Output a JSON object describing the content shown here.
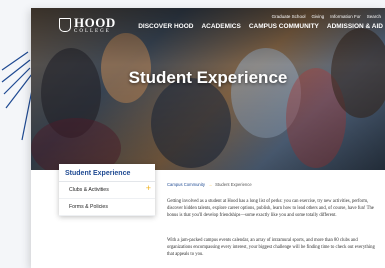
{
  "logo": {
    "name": "HOOD",
    "sub": "COLLEGE"
  },
  "utility_links": [
    "Graduate School",
    "Giving",
    "Information For",
    "Search"
  ],
  "nav": [
    "DISCOVER HOOD",
    "ACADEMICS",
    "CAMPUS COMMUNITY",
    "ADMISSION & AID"
  ],
  "hero": {
    "title": "Student Experience"
  },
  "sidemenu": {
    "heading": "Student Experience",
    "items": [
      "Clubs & Activities",
      "Forms & Policies"
    ]
  },
  "breadcrumb": {
    "parent": "Campus Community",
    "separator": "→",
    "current": "Student Experience"
  },
  "content": {
    "p1": "Getting involved as a student at Hood has a long list of perks: you can exercise, try new activities, perform, discover hidden talents, explore career options, publish, learn how to lead others and, of course, have fun! The bonus is that you'll develop friendships—some exactly like you and some totally different.",
    "p2": "With a jam-packed campus events calendar, an array of intramural sports, and more than 80 clubs and organizations encompassing every interest, your biggest challenge will be finding time to check out everything that appeals to you."
  },
  "colors": {
    "brand_blue": "#1f4a92",
    "accent_gold": "#f0b11b"
  }
}
